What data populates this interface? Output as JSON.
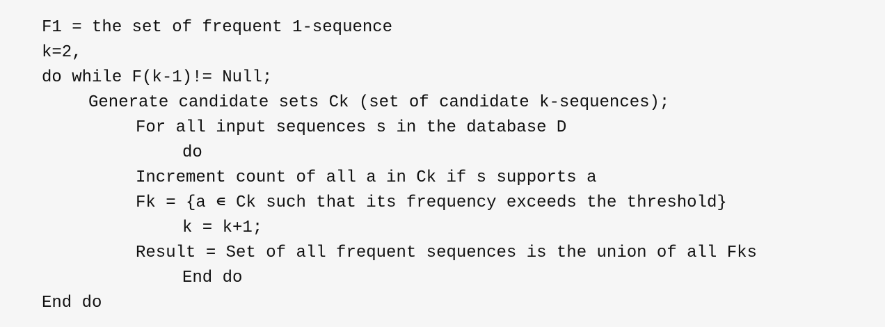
{
  "code": {
    "lines": [
      "F1 = the set of frequent 1-sequence",
      "k=2,",
      "do while F(k-1)!= Null;",
      "Generate candidate sets Ck (set of candidate k-sequences);",
      "For all input sequences s in the database D",
      "do",
      "Increment count of all a in Ck if s supports a",
      "Fk = {a ∊ Ck such that its frequency exceeds the threshold}",
      "k = k+1;",
      "Result = Set of all frequent sequences is the union of all Fks",
      "End do",
      "End do"
    ]
  }
}
